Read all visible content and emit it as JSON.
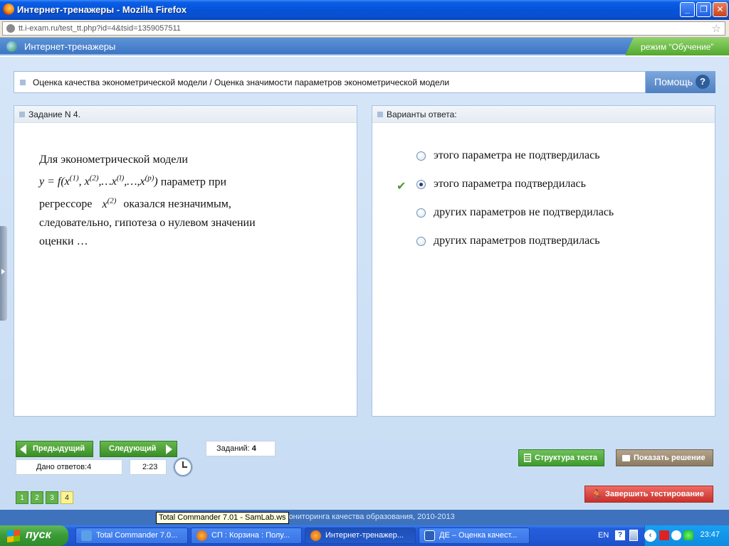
{
  "window": {
    "title": "Интернет-тренажеры - Mozilla Firefox",
    "minimize": "_",
    "maximize": "❐",
    "close": "✕"
  },
  "addressbar": {
    "url": "tt.i-exam.ru/test_tt.php?id=4&tsid=1359057511",
    "star_icon": "☆"
  },
  "app": {
    "name": "Интернет-тренажеры",
    "mode_label": "режим “Обучение”"
  },
  "topic": {
    "text": "Оценка качества эконометрической модели / Оценка значимости параметров эконометрической модели"
  },
  "help": {
    "label": "Помощь",
    "icon": "?"
  },
  "task_panel": {
    "header": "Задание N 4."
  },
  "question": {
    "line1": "Для эконометрической модели",
    "formula_y": "y = f",
    "after_formula": " параметр при",
    "line3_pre": "регрессоре",
    "line3_post": "оказался незначимым,",
    "line4": "следовательно, гипотеза о нулевом значении",
    "line5": "оценки …"
  },
  "answers_panel": {
    "header": "Варианты ответа:"
  },
  "answers": [
    {
      "text": "этого параметра не подтвердилась",
      "selected": false
    },
    {
      "text": "этого параметра подтвердилась",
      "selected": true
    },
    {
      "text": "других параметров не подтвердилась",
      "selected": false
    },
    {
      "text": "других параметров подтвердилась",
      "selected": false
    }
  ],
  "check_icon": "✔",
  "nav": {
    "prev_label": "Предыдущий",
    "next_label": "Следующий",
    "tasks_label": "Заданий:",
    "tasks_count": "4",
    "answers_given_label": "Дано ответов:",
    "answers_given_count": "4",
    "timer": "2:23"
  },
  "actions": {
    "structure": "Структура теста",
    "show_solution": "Показать решение",
    "finish": "Завершить тестирование"
  },
  "pages": [
    "1",
    "2",
    "3",
    "4"
  ],
  "current_page": "4",
  "footer": {
    "text": "мониторинга качества образования, 2010-2013"
  },
  "tooltip": "Total Commander 7.01 - SamLab.ws",
  "taskbar": {
    "start": "пуск",
    "tasks": [
      {
        "label": "Total Commander 7.0...",
        "icon": "total-commander-icon"
      },
      {
        "label": "СП : Корзина : Полу...",
        "icon": "firefox-icon"
      },
      {
        "label": "Интернет-тренажер...",
        "icon": "firefox-icon"
      },
      {
        "label": "ДЕ – Оценка качест...",
        "icon": "word-icon"
      }
    ],
    "lang": "EN",
    "clock": "23:47"
  },
  "colors": {
    "accent_green": "#4a9a35",
    "header_blue": "#3d75c4",
    "finish_red": "#d9494a"
  }
}
